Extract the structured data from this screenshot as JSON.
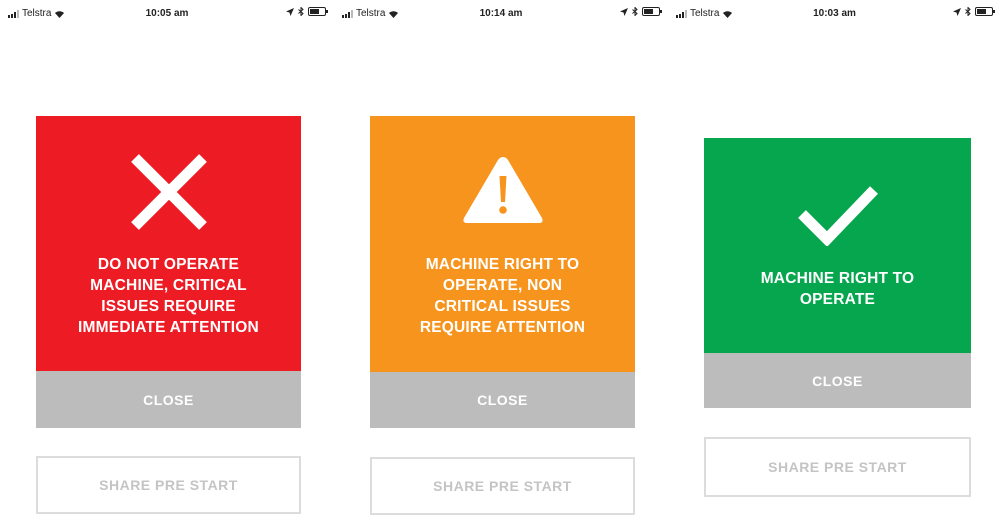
{
  "panels": [
    {
      "status_bar": {
        "carrier": "Telstra",
        "time": "10:05 am"
      },
      "card": {
        "variant": "critical",
        "color": "#ed1c24",
        "icon": "close-x-icon",
        "message": "DO NOT OPERATE\nMACHINE, CRITICAL\nISSUES REQUIRE\nIMMEDIATE ATTENTION",
        "close_label": "CLOSE"
      },
      "share_label": "SHARE PRE START"
    },
    {
      "status_bar": {
        "carrier": "Telstra",
        "time": "10:14 am"
      },
      "card": {
        "variant": "warning",
        "color": "#f7941d",
        "icon": "warning-triangle-icon",
        "message": "MACHINE RIGHT TO\nOPERATE, NON\nCRITICAL ISSUES\nREQUIRE ATTENTION",
        "close_label": "CLOSE"
      },
      "share_label": "SHARE PRE START"
    },
    {
      "status_bar": {
        "carrier": "Telstra",
        "time": "10:03 am"
      },
      "card": {
        "variant": "ok",
        "color": "#06a64f",
        "icon": "checkmark-icon",
        "message": "MACHINE RIGHT TO\nOPERATE",
        "close_label": "CLOSE"
      },
      "share_label": "SHARE PRE START"
    }
  ]
}
